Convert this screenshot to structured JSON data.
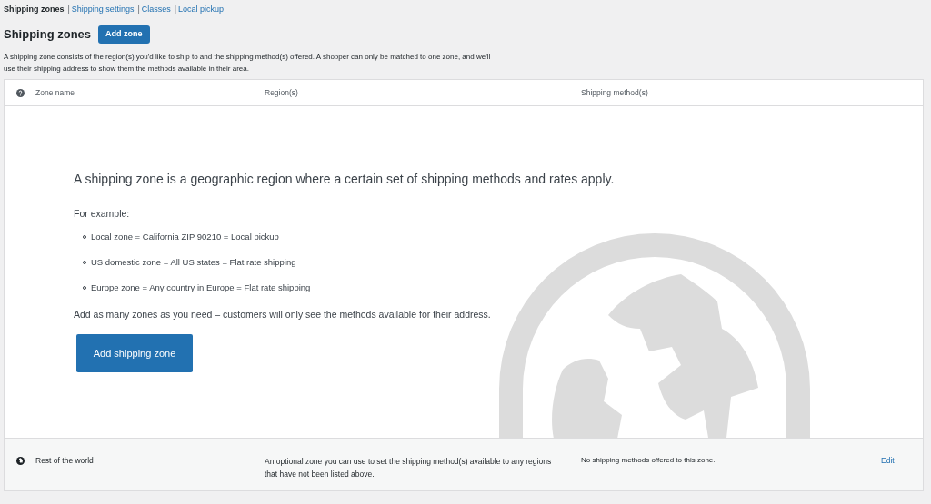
{
  "tabs": [
    {
      "label": "Shipping zones",
      "selected": true
    },
    {
      "separator": "|",
      "label": "Shipping settings",
      "selected": false
    },
    {
      "separator": "|",
      "label": "Classes",
      "selected": false
    },
    {
      "separator": "|",
      "label": "Local pickup",
      "selected": false
    }
  ],
  "heading": "Shipping zones",
  "add_zone_button": "Add zone",
  "description": "A shipping zone consists of the region(s) you'd like to ship to and the shipping method(s) offered. A shopper can only be matched to one zone, and we'll use their shipping address to show them the methods available in their area.",
  "table": {
    "columns": [
      "Zone name",
      "Region(s)",
      "Shipping method(s)"
    ],
    "empty_state": {
      "title": "A shipping zone is a geographic region where a certain set of shipping methods and rates apply.",
      "intro": "For example:",
      "examples": [
        "Local zone = California ZIP 90210 = Local pickup",
        "US domestic zone = All US states = Flat rate shipping",
        "Europe zone = Any country in Europe = Flat rate shipping"
      ],
      "note": "Add as many zones as you need – customers will only see the methods available for their address.",
      "button": "Add shipping zone"
    },
    "rest_of_world": {
      "name": "Rest of the world",
      "region": "An optional zone you can use to set the shipping method(s) available to any regions that have not been listed above.",
      "methods": "No shipping methods offered to this zone.",
      "action": "Edit"
    }
  }
}
